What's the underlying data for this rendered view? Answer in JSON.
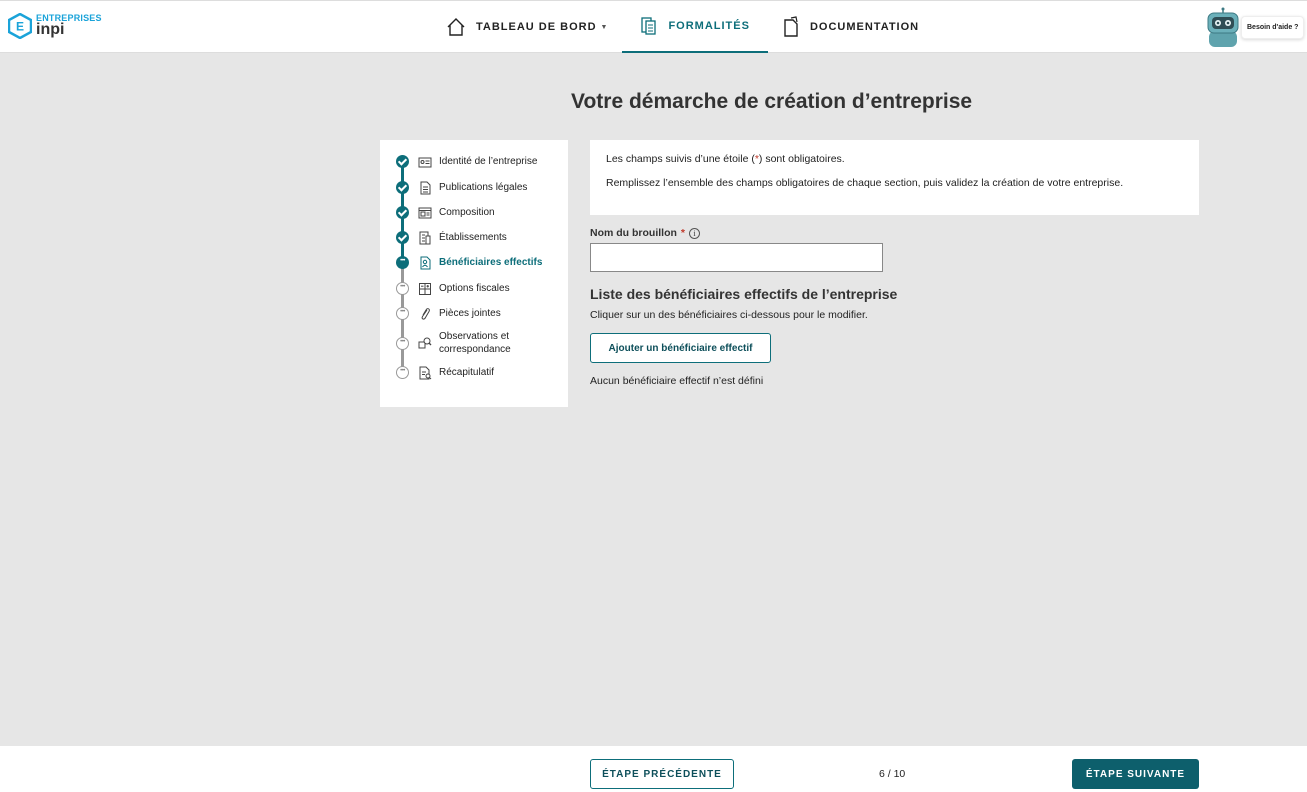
{
  "header": {
    "logo": {
      "top": "ENTREPRISES",
      "bottom": "inpi"
    },
    "nav": [
      {
        "label": "TABLEAU DE BORD",
        "icon": "home-icon"
      },
      {
        "label": "FORMALITÉS",
        "icon": "documents-icon"
      },
      {
        "label": "DOCUMENTATION",
        "icon": "document-icon"
      }
    ],
    "help_label": "Besoin d'aide ?"
  },
  "page_title": "Votre démarche de création d’entreprise",
  "steps": [
    {
      "label": "Identité de l’entreprise",
      "state": "done",
      "icon": "id-card-icon"
    },
    {
      "label": "Publications légales",
      "state": "done",
      "icon": "document-icon"
    },
    {
      "label": "Composition",
      "state": "done",
      "icon": "newspaper-icon"
    },
    {
      "label": "Établissements",
      "state": "done",
      "icon": "building-icon"
    },
    {
      "label": "Bénéficiaires effectifs",
      "state": "current",
      "icon": "beneficiary-icon"
    },
    {
      "label": "Options fiscales",
      "state": "todo",
      "icon": "calculator-icon"
    },
    {
      "label": "Pièces jointes",
      "state": "todo",
      "icon": "paperclip-icon"
    },
    {
      "label": "Observations et correspondance",
      "state": "todo",
      "icon": "search-document-icon"
    },
    {
      "label": "Récapitulatif",
      "state": "todo",
      "icon": "summary-icon"
    }
  ],
  "info": {
    "line1_prefix": "Les champs suivis d’une étoile (",
    "line1_star": "*",
    "line1_suffix": ") sont obligatoires.",
    "line2": "Remplissez l’ensemble des champs obligatoires de chaque section, puis validez la création de votre entreprise."
  },
  "draft": {
    "label": "Nom du brouillon",
    "required_mark": "*",
    "info_glyph": "i",
    "value": ""
  },
  "beneficiaries": {
    "title": "Liste des bénéficiaires effectifs de l’entreprise",
    "subtitle": "Cliquer sur un des bénéficiaires ci-dessous pour le modifier.",
    "add_button": "Ajouter un bénéficiaire effectif",
    "empty_message": "Aucun bénéficiaire effectif n’est défini"
  },
  "footer": {
    "prev_button": "ÉTAPE PRÉCÉDENTE",
    "page_count": "6 / 10",
    "next_button": "ÉTAPE SUIVANTE"
  },
  "colors": {
    "primary": "#0d6e7a",
    "logo_blue": "#1aa3d9",
    "background": "#e6e6e6",
    "required": "#c0392b"
  }
}
